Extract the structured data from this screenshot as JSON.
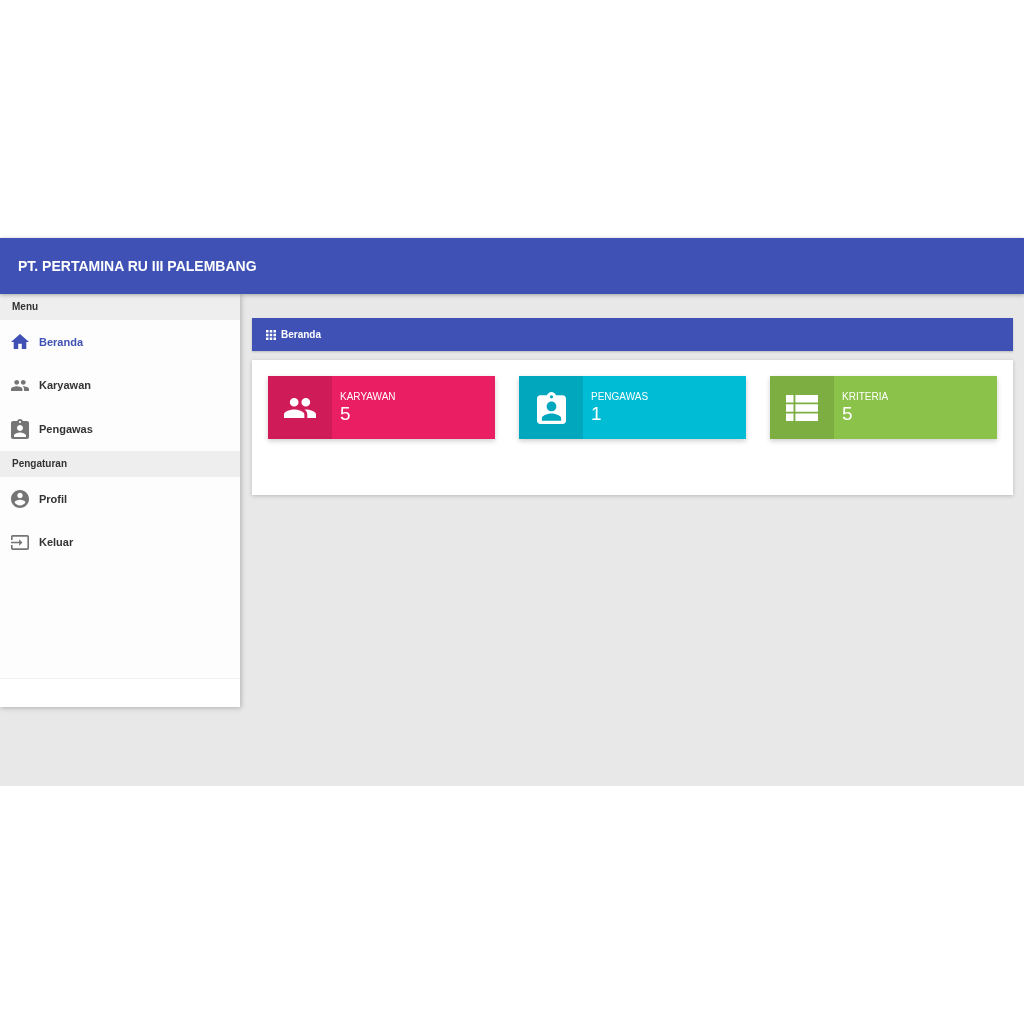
{
  "header": {
    "title": "PT. PERTAMINA RU III PALEMBANG"
  },
  "sidebar": {
    "sections": [
      {
        "heading": "Menu",
        "items": [
          {
            "label": "Beranda",
            "kind": "home",
            "selected": true
          },
          {
            "label": "Karyawan",
            "kind": "people",
            "selected": false
          },
          {
            "label": "Pengawas",
            "kind": "badge",
            "selected": false
          }
        ]
      },
      {
        "heading": "Pengaturan",
        "items": [
          {
            "label": "Profil",
            "kind": "account",
            "selected": false
          },
          {
            "label": "Keluar",
            "kind": "logout",
            "selected": false
          }
        ]
      }
    ]
  },
  "breadcrumb": {
    "label": "Beranda"
  },
  "info_boxes": [
    {
      "label": "KARYAWAN",
      "value": "5",
      "kind": "people",
      "color": "#e91e63"
    },
    {
      "label": "PENGAWAS",
      "value": "1",
      "kind": "badge",
      "color": "#00bcd4"
    },
    {
      "label": "KRITERIA",
      "value": "5",
      "kind": "list",
      "color": "#8bc34a"
    }
  ]
}
